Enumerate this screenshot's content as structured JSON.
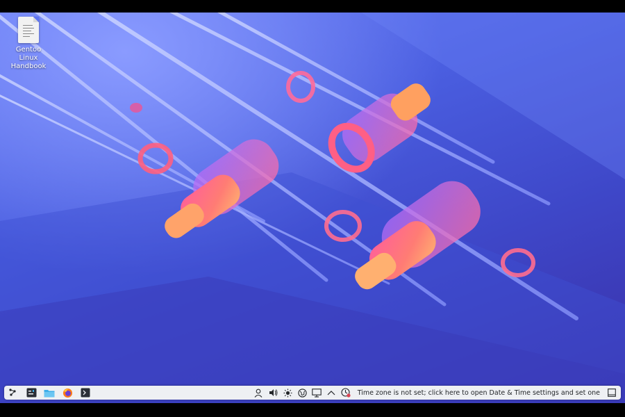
{
  "desktop": {
    "icons": [
      {
        "label": "Gentoo Linux Handbook",
        "icon": "document-file-icon"
      }
    ]
  },
  "taskbar": {
    "launchers": [
      {
        "name": "application-launcher",
        "icon": "app-launcher-icon"
      },
      {
        "name": "system-settings",
        "icon": "settings-icon"
      },
      {
        "name": "file-manager",
        "icon": "folder-icon"
      },
      {
        "name": "firefox",
        "icon": "firefox-icon"
      },
      {
        "name": "terminal",
        "icon": "terminal-icon"
      }
    ],
    "tray": {
      "icons": [
        "user-icon",
        "volume-icon",
        "brightness-icon",
        "network-icon",
        "display-icon",
        "expand-tray-icon",
        "clock-warning-icon"
      ],
      "clock_message": "Time zone is not set; click here to open Date & Time settings and set one"
    }
  },
  "colors": {
    "taskbar_bg": "#eef0f3",
    "wallpaper_blue": "#4a5ee0",
    "accent_orange": "#ff9a5a",
    "accent_pink": "#ff5f8a"
  }
}
